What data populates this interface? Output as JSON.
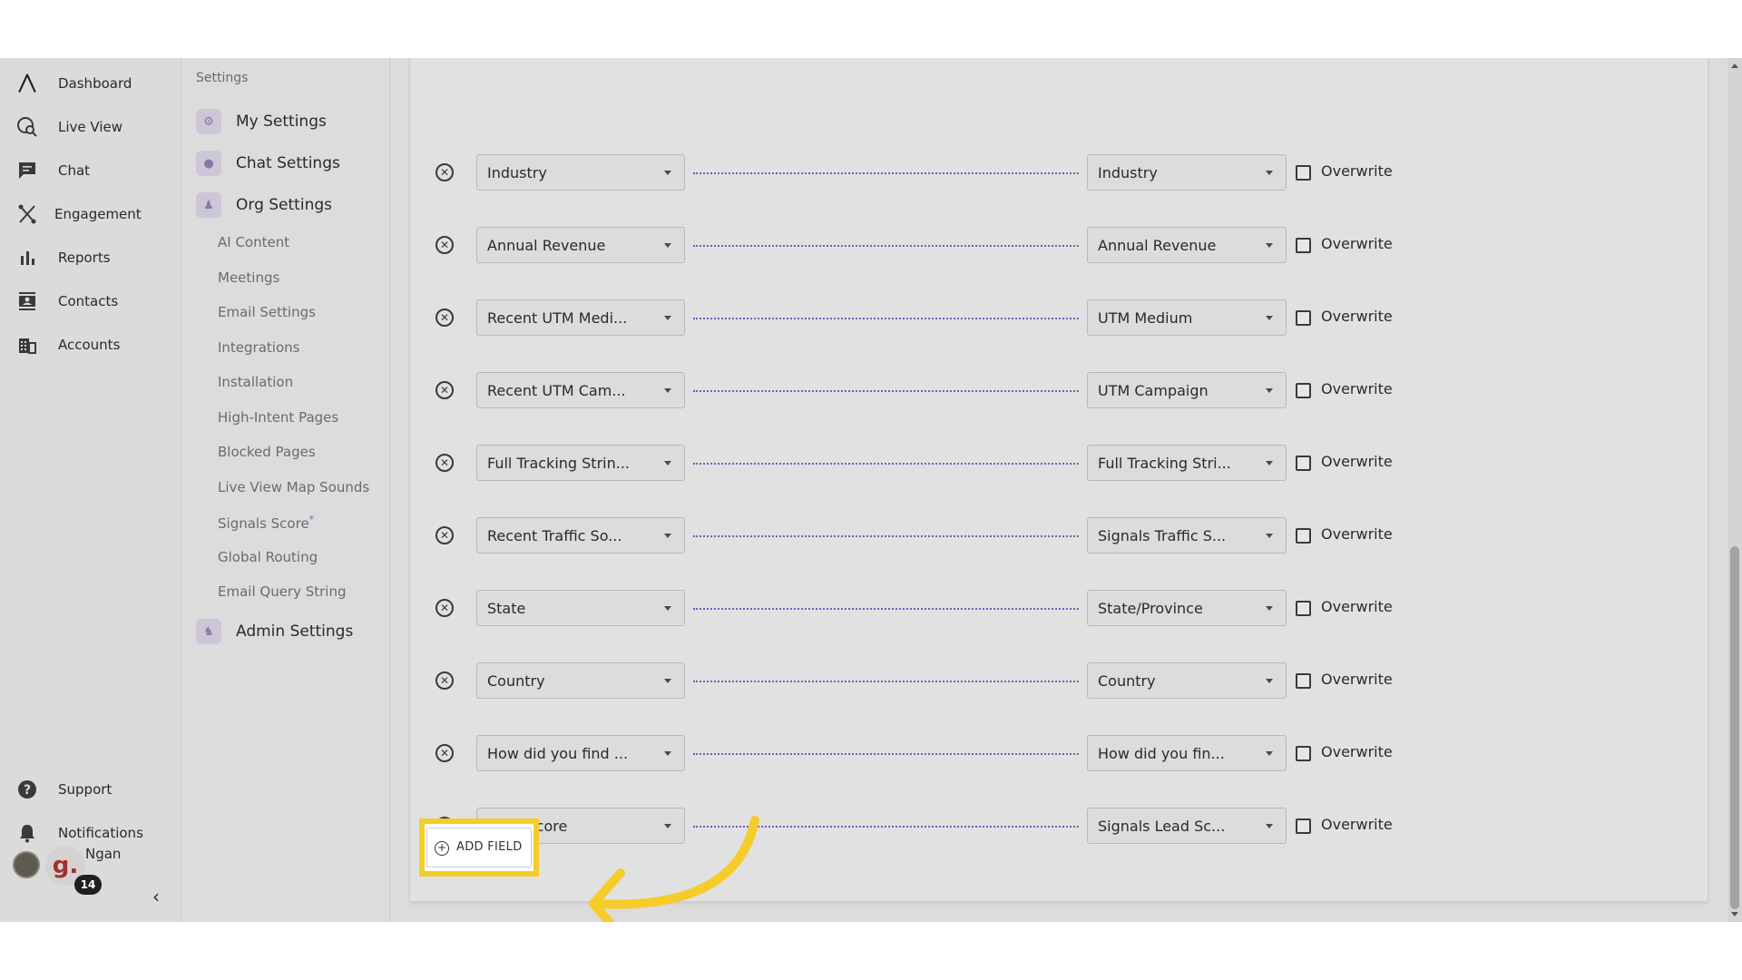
{
  "nav": {
    "items": [
      {
        "label": "Dashboard",
        "icon": "logo-icon"
      },
      {
        "label": "Live View",
        "icon": "globe-search-icon"
      },
      {
        "label": "Chat",
        "icon": "chat-icon"
      },
      {
        "label": "Engagement",
        "icon": "engagement-icon"
      },
      {
        "label": "Reports",
        "icon": "bar-chart-icon"
      },
      {
        "label": "Contacts",
        "icon": "contacts-icon"
      },
      {
        "label": "Accounts",
        "icon": "building-icon"
      }
    ],
    "bottom": [
      {
        "label": "Support",
        "icon": "help-icon"
      },
      {
        "label": "Notifications",
        "icon": "bell-icon"
      }
    ],
    "user": {
      "name": "Ngan",
      "initial": "g.",
      "badge": "14"
    },
    "collapse": "‹"
  },
  "settings": {
    "title": "Settings",
    "sections": [
      "My Settings",
      "Chat Settings",
      "Org Settings",
      "Admin Settings"
    ],
    "sub_items": [
      "AI Content",
      "Meetings",
      "Email Settings",
      "Integrations",
      "Installation",
      "High-Intent Pages",
      "Blocked Pages",
      "Live View Map Sounds",
      "Signals Score",
      "Global Routing",
      "Email Query String"
    ],
    "signals_star": "*"
  },
  "mappings": [
    {
      "left": "Industry",
      "right": "Industry"
    },
    {
      "left": "Annual Revenue",
      "right": "Annual Revenue"
    },
    {
      "left": "Recent UTM Medi...",
      "right": "UTM Medium"
    },
    {
      "left": "Recent UTM Cam...",
      "right": "UTM Campaign"
    },
    {
      "left": "Full Tracking Strin...",
      "right": "Full Tracking Stri..."
    },
    {
      "left": "Recent Traffic So...",
      "right": "Signals Traffic S..."
    },
    {
      "left": "State",
      "right": "State/Province"
    },
    {
      "left": "Country",
      "right": "Country"
    },
    {
      "left": "How did you find ...",
      "right": "How did you fin..."
    },
    {
      "left": "Lead Score",
      "right": "Signals Lead Sc..."
    }
  ],
  "overwrite_label": "Overwrite",
  "add_field_label": "ADD FIELD",
  "colors": {
    "highlight": "#f6cc2a",
    "connector": "#6a62b8",
    "accent": "#8a78a8"
  }
}
